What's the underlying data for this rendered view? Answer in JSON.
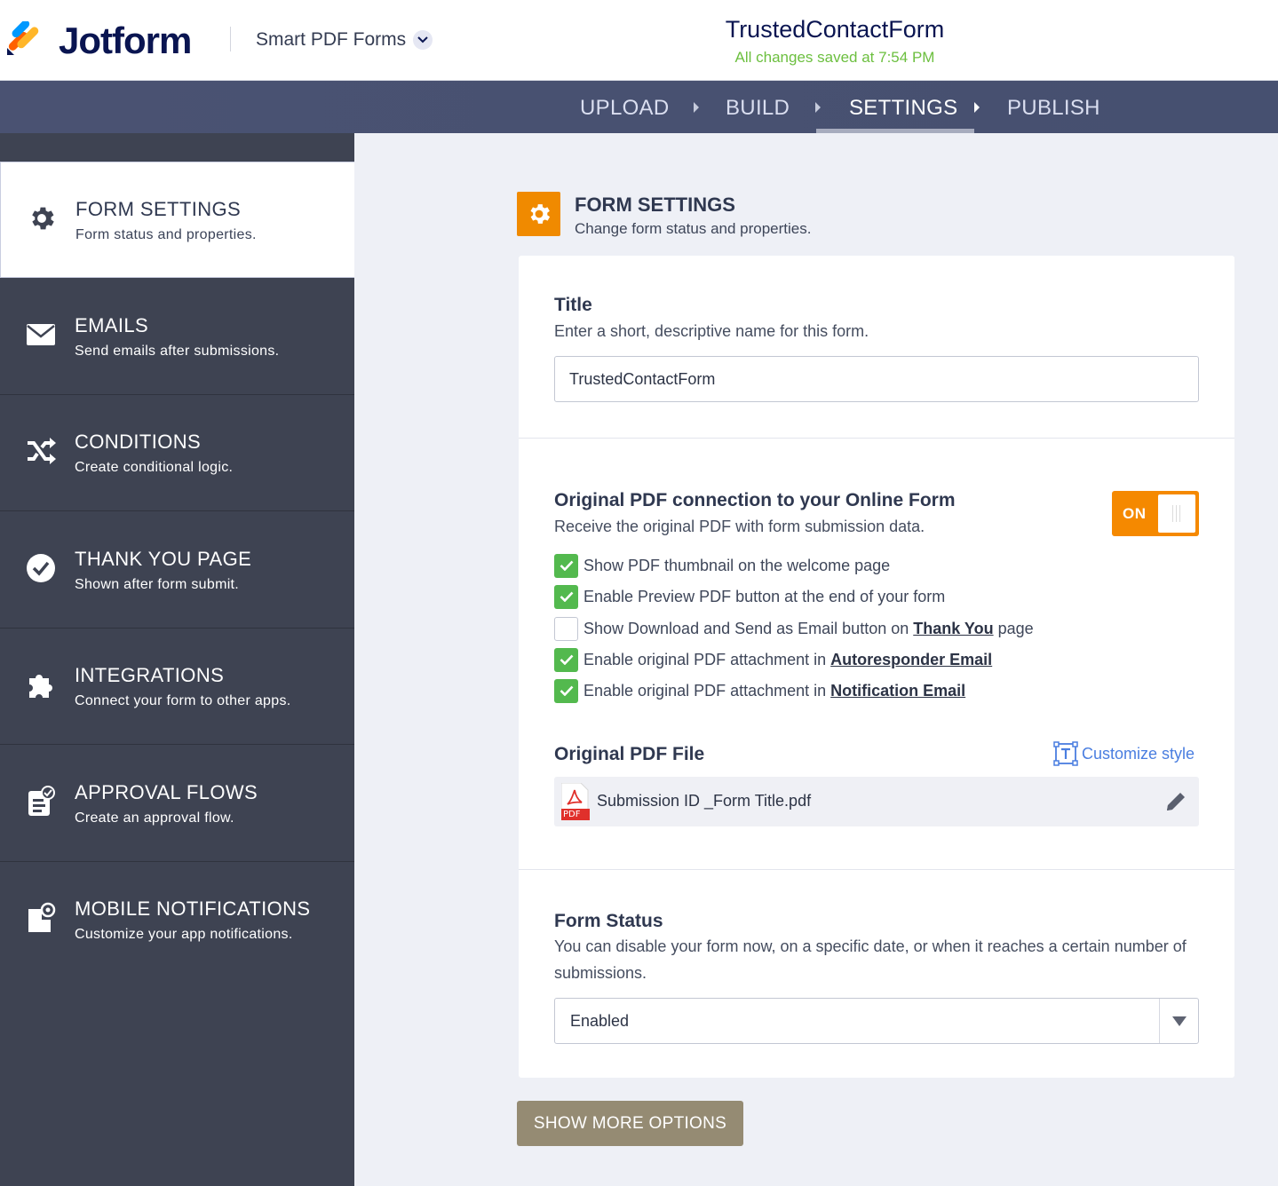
{
  "header": {
    "brand": "Jotform",
    "product": "Smart PDF Forms",
    "form_title": "TrustedContactForm",
    "save_status": "All changes saved at 7:54 PM"
  },
  "nav": {
    "steps": [
      {
        "label": "UPLOAD",
        "active": false
      },
      {
        "label": "BUILD",
        "active": false
      },
      {
        "label": "SETTINGS",
        "active": true
      },
      {
        "label": "PUBLISH",
        "active": false
      }
    ]
  },
  "sidebar": {
    "items": [
      {
        "title": "FORM SETTINGS",
        "subtitle": "Form status and properties.",
        "icon": "gear-icon",
        "active": true
      },
      {
        "title": "EMAILS",
        "subtitle": "Send emails after submissions.",
        "icon": "envelope-icon",
        "active": false
      },
      {
        "title": "CONDITIONS",
        "subtitle": "Create conditional logic.",
        "icon": "shuffle-icon",
        "active": false
      },
      {
        "title": "THANK YOU PAGE",
        "subtitle": "Shown after form submit.",
        "icon": "check-circle-icon",
        "active": false
      },
      {
        "title": "INTEGRATIONS",
        "subtitle": "Connect your form to other apps.",
        "icon": "puzzle-icon",
        "active": false
      },
      {
        "title": "APPROVAL FLOWS",
        "subtitle": "Create an approval flow.",
        "icon": "approval-icon",
        "active": false
      },
      {
        "title": "MOBILE NOTIFICATIONS",
        "subtitle": "Customize your app notifications.",
        "icon": "mobile-notification-icon",
        "active": false
      }
    ]
  },
  "main": {
    "section_title": "FORM SETTINGS",
    "section_subtitle": "Change form status and properties.",
    "title_field": {
      "label": "Title",
      "description": "Enter a short, descriptive name for this form.",
      "value": "TrustedContactForm"
    },
    "pdf_connection": {
      "label": "Original PDF connection to your Online Form",
      "description": "Receive the original PDF with form submission data.",
      "toggle_label": "ON",
      "options": [
        {
          "text": "Show PDF thumbnail on the welcome page",
          "checked": true
        },
        {
          "text": "Enable Preview PDF button at the end of your form",
          "checked": true
        },
        {
          "text": "Show Download and Send as Email button on",
          "link": "Thank You",
          "after": "page",
          "checked": false
        },
        {
          "text": "Enable original PDF attachment in",
          "link": "Autoresponder Email",
          "checked": true
        },
        {
          "text": "Enable original PDF attachment in",
          "link": "Notification Email",
          "checked": true
        }
      ]
    },
    "pdf_file": {
      "label": "Original PDF File",
      "customize_label": "Customize style",
      "file_name": "Submission ID _Form Title.pdf",
      "file_badge": "PDF"
    },
    "form_status": {
      "label": "Form Status",
      "description": "You can disable your form now, on a specific date, or when it reaches a certain number of submissions.",
      "selected": "Enabled"
    },
    "show_more_label": "SHOW MORE OPTIONS"
  },
  "colors": {
    "accent": "#f58900",
    "nav_bg": "#4a5272",
    "sidebar_bg": "#3e4352",
    "check_green": "#53b94e",
    "button": "#958b73"
  }
}
